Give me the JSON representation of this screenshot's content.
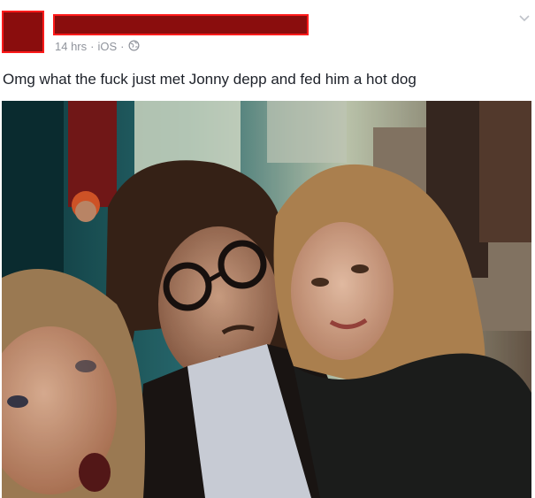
{
  "post": {
    "author_redacted": true,
    "timestamp": "14 hrs",
    "source": "iOS",
    "separator": "·",
    "privacy_icon": "globe-icon",
    "menu_icon": "chevron-down-icon",
    "text": "Omg what the fuck just met Jonny depp and fed him a hot dog",
    "photo": {
      "kind": "selfie of three people at night on a street"
    }
  },
  "colors": {
    "redaction_fill": "#8a0d0d",
    "redaction_border": "#ff1a1a",
    "meta_text": "#90949c",
    "body_text": "#1d2129"
  }
}
